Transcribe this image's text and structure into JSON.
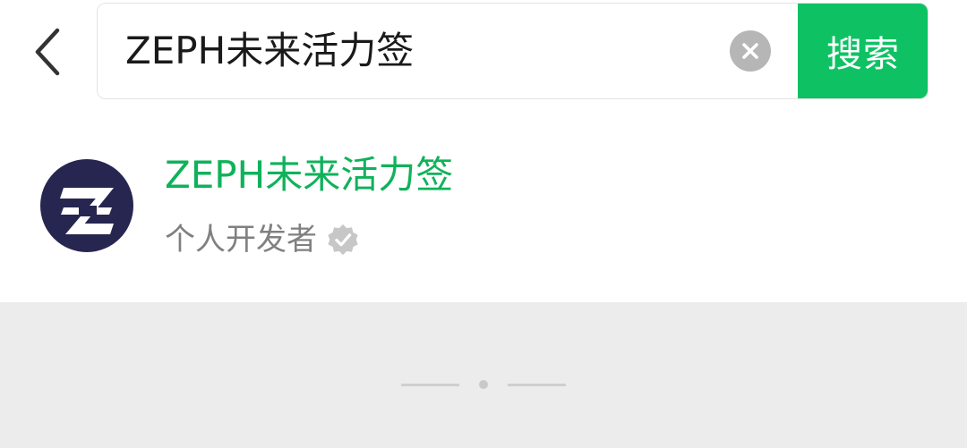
{
  "header": {
    "back_icon": "chevron-left-icon",
    "search": {
      "value": "ZEPH未来活力签",
      "placeholder": "",
      "clear_icon": "close-circle-icon"
    },
    "search_button_label": "搜索"
  },
  "results": [
    {
      "title": "ZEPH未来活力签",
      "subtitle": "个人开发者",
      "avatar_icon": "zeph-logo-icon",
      "badge_icon": "verified-badge-icon"
    }
  ],
  "colors": {
    "accent": "#0ec264",
    "title_green": "#0fb25a",
    "avatar_bg": "#272650",
    "footer_bg": "#ececec"
  }
}
